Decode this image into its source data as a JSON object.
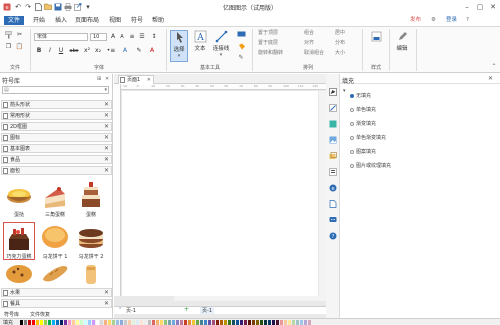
{
  "titlebar": {
    "title": "亿图图示（试用版）",
    "quick_access": [
      "undo-icon",
      "redo-icon",
      "new-icon",
      "open-icon",
      "save-icon",
      "print-icon",
      "export-icon",
      "dropdown-icon"
    ]
  },
  "menubar": {
    "items": [
      {
        "label": "文件",
        "active": true
      },
      {
        "label": "开始",
        "active": false
      },
      {
        "label": "插入",
        "active": false
      },
      {
        "label": "页面布局",
        "active": false
      },
      {
        "label": "视图",
        "active": false
      },
      {
        "label": "符号",
        "active": false
      },
      {
        "label": "帮助",
        "active": false
      }
    ],
    "right": {
      "publish": "发布",
      "settings_icon": "gear-icon",
      "login": "登录",
      "help_icon": "help-icon"
    }
  },
  "ribbon": {
    "groups": {
      "file": "文件",
      "font": "字体",
      "basic_tools": "基本工具",
      "arrange": "排列",
      "style": "样式",
      "edit": "编辑"
    },
    "font_name": "宋体",
    "font_size": "10",
    "text_buttons": {
      "bold": "B",
      "italic": "I",
      "underline": "U",
      "strike": "abc"
    },
    "select_label": "选择",
    "text_label": "文本",
    "connector_label": "连接线",
    "arrange_items": [
      "置于顶层",
      "置于底层",
      "旋转和翻转",
      "组合",
      "对齐",
      "取消组合",
      "居中",
      "分布",
      "大小"
    ],
    "style_label": "样式",
    "edit_label": "编辑",
    "colors": {
      "accent": "#2d6bb5",
      "brand_red": "#d9534f"
    }
  },
  "left_panel": {
    "title": "符号库",
    "categories_top": [
      {
        "label": "箭头形状"
      },
      {
        "label": "常用形状"
      },
      {
        "label": "2D框图"
      },
      {
        "label": "图标"
      },
      {
        "label": "基本图表"
      },
      {
        "label": "食品"
      },
      {
        "label": "面包"
      }
    ],
    "foods": [
      {
        "label": "蛋挞"
      },
      {
        "label": "三角蛋糕"
      },
      {
        "label": "蛋糕"
      },
      {
        "label": "巧克力蛋糕",
        "selected": true
      },
      {
        "label": "马龙饼干 1"
      },
      {
        "label": "马龙饼干 2"
      }
    ],
    "categories_bottom": [
      {
        "label": "水果"
      },
      {
        "label": "餐具"
      }
    ],
    "tabs": [
      "符号库",
      "文件恢复"
    ]
  },
  "canvas": {
    "tab_label": "页面1",
    "ruler_ticks": [
      "-10",
      "0",
      "10",
      "20",
      "30",
      "40",
      "50",
      "60",
      "70",
      "80",
      "90",
      "100",
      "110",
      "120"
    ],
    "page_prev": "页-1",
    "page_add": "+",
    "page_current": "页-1"
  },
  "fill_panel": {
    "title": "填充",
    "options": [
      {
        "label": "无填充",
        "selected": true
      },
      {
        "label": "单色填充",
        "selected": false
      },
      {
        "label": "渐变填充",
        "selected": false
      },
      {
        "label": "单色渐变填充",
        "selected": false
      },
      {
        "label": "图案填充",
        "selected": false
      },
      {
        "label": "图片或纹理填充",
        "selected": false
      }
    ]
  },
  "statusbar": {
    "fill_label": "填充",
    "palette": [
      "#000000",
      "#7f7f7f",
      "#c00000",
      "#ff0000",
      "#ffc000",
      "#ffff00",
      "#92d050",
      "#00b050",
      "#00b0f0",
      "#0070c0",
      "#002060",
      "#7030a0",
      "#ff99cc",
      "#ffcc99",
      "#ffff99",
      "#ccffcc",
      "#ccffff",
      "#99ccff",
      "#cc99ff",
      "#ffffff",
      "#d9d9d9",
      "#f4b183",
      "#ffd966",
      "#a9d08e",
      "#9bc2e6",
      "#8ea9db",
      "#c9c9c9",
      "#f8cbad",
      "#e2efda",
      "#ddebf7",
      "#fce4d6",
      "#ededed",
      "#bfbfbf",
      "#e06666",
      "#f6b26b",
      "#ffd966",
      "#93c47d",
      "#76a5af",
      "#6fa8dc",
      "#8e7cc3",
      "#c27ba0",
      "#cc4125",
      "#e69138",
      "#f1c232",
      "#6aa84f",
      "#45818e",
      "#3d85c6",
      "#674ea7",
      "#a64d79",
      "#85200c",
      "#b45f06",
      "#bf9000",
      "#38761d",
      "#134f5c",
      "#0b5394",
      "#351c75",
      "#741b47",
      "#5b0f00",
      "#783f04",
      "#7f6000",
      "#274e13",
      "#0c343d",
      "#073763",
      "#20124d",
      "#4c1130",
      "#ea9999",
      "#f9cb9c",
      "#ffe599",
      "#b6d7a8",
      "#a2c4c9",
      "#9fc5e8",
      "#b4a7d6",
      "#d5a6bd"
    ]
  }
}
